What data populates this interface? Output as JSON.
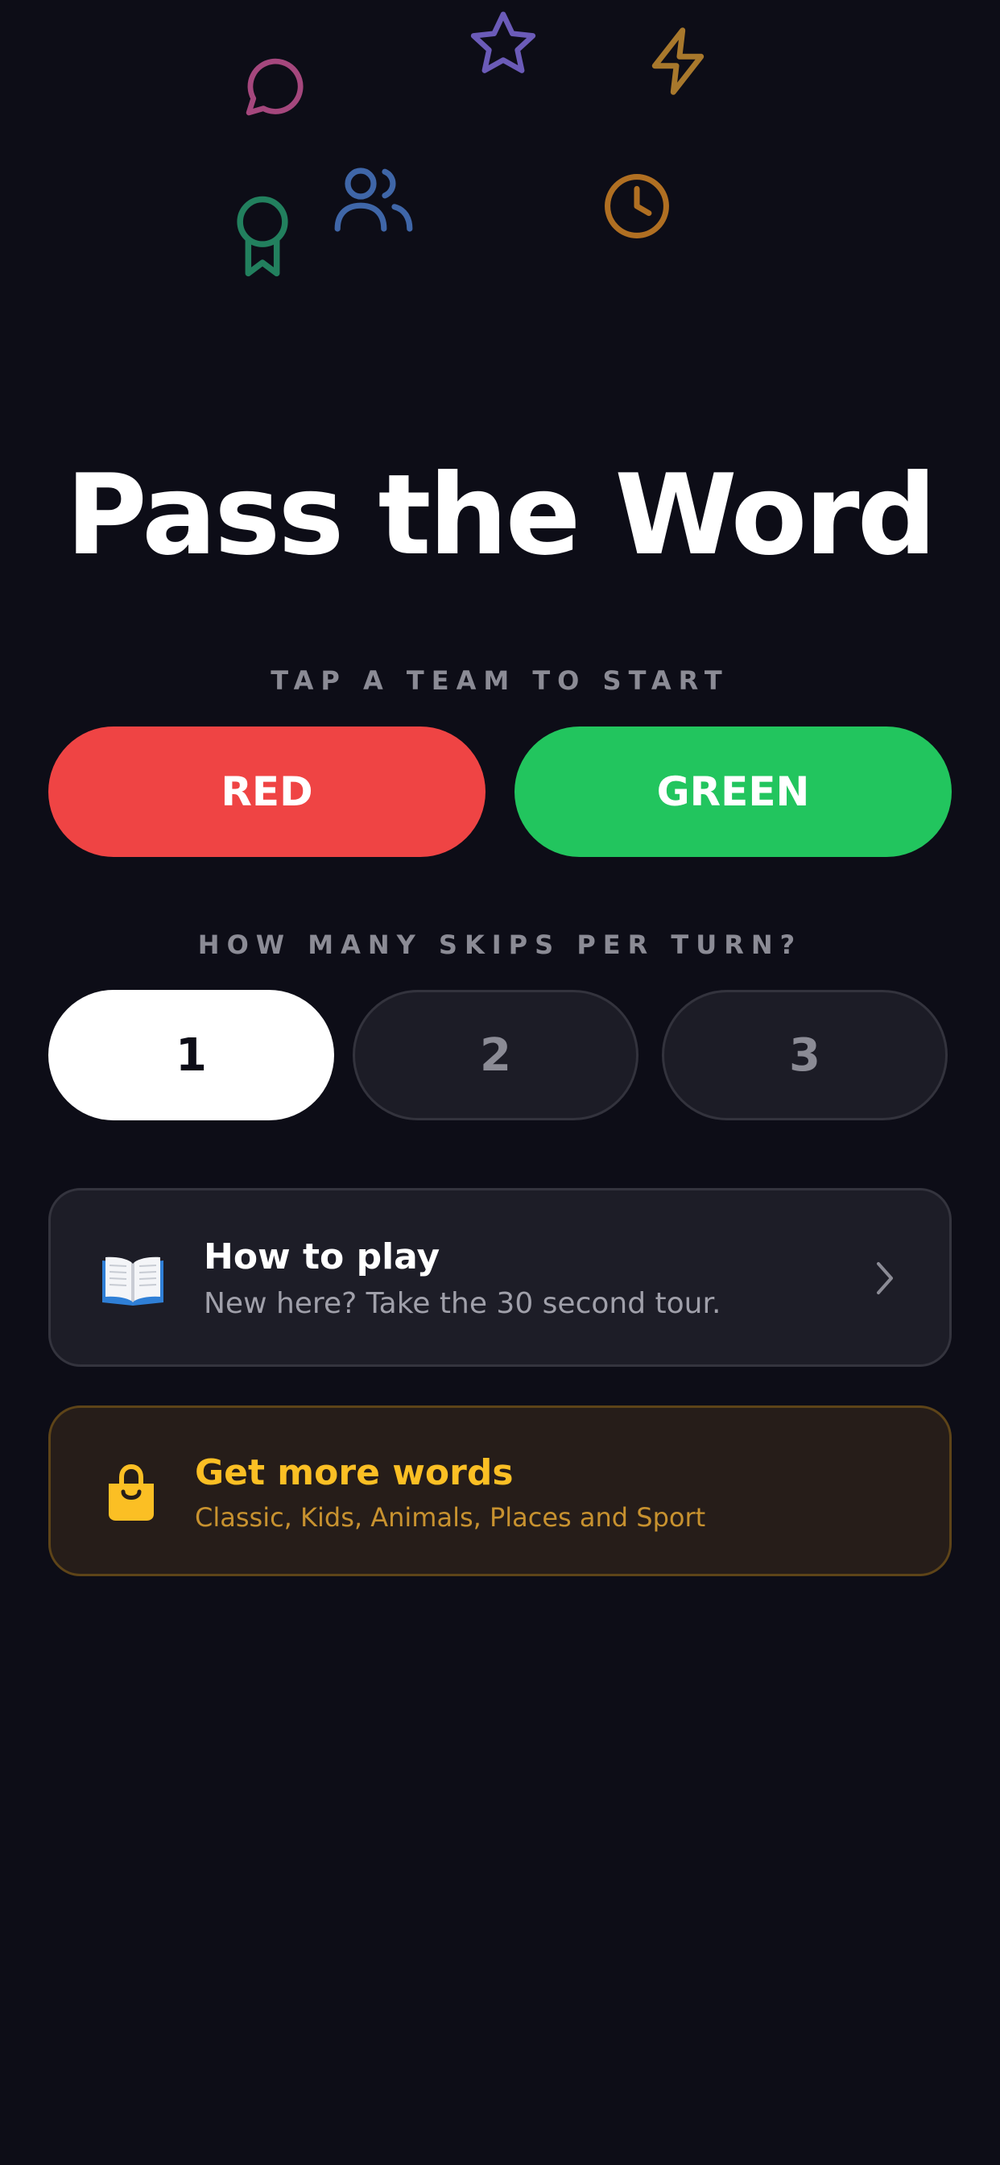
{
  "app": {
    "title": "Pass the Word"
  },
  "decorations": [
    {
      "icon": "chat-bubble-icon",
      "color": "#a5477d"
    },
    {
      "icon": "star-icon",
      "color": "#6b5bb8"
    },
    {
      "icon": "lightning-icon",
      "color": "#a8782c"
    },
    {
      "icon": "award-ribbon-icon",
      "color": "#22805e"
    },
    {
      "icon": "users-icon",
      "color": "#3f66a8"
    },
    {
      "icon": "clock-icon",
      "color": "#b06f22"
    }
  ],
  "teams": {
    "label": "TAP A TEAM TO START",
    "options": [
      {
        "label": "RED",
        "color": "#ef4444"
      },
      {
        "label": "GREEN",
        "color": "#22c55e"
      }
    ]
  },
  "skips": {
    "label": "HOW MANY SKIPS PER TURN?",
    "options": [
      "1",
      "2",
      "3"
    ],
    "selected": "1"
  },
  "how_to_play": {
    "icon": "open-book-icon",
    "title": "How to play",
    "subtitle": "New here? Take the 30 second tour.",
    "chevron": "chevron-right-icon"
  },
  "store": {
    "icon": "shopping-bag-icon",
    "title": "Get more words",
    "subtitle": "Classic, Kids, Animals, Places and Sport",
    "accent": "#fbbf24",
    "subtitle_color": "#c8922f"
  }
}
